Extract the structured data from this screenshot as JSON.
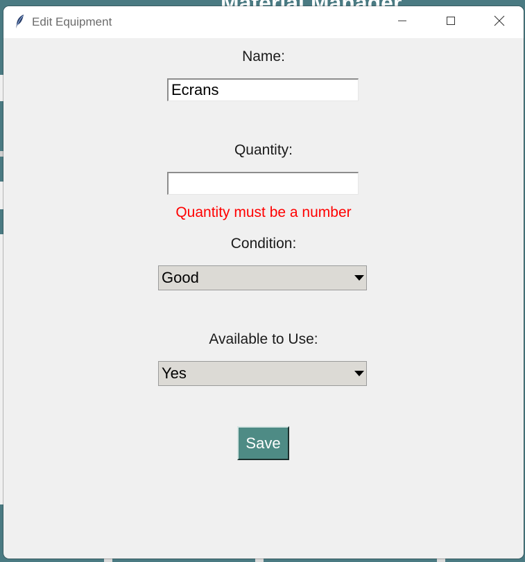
{
  "background_app": {
    "title": "Material Manager"
  },
  "window": {
    "title": "Edit Equipment",
    "icon": "feather-icon",
    "controls": {
      "minimize_icon": "minimize-icon",
      "maximize_icon": "maximize-icon",
      "close_icon": "close-icon"
    }
  },
  "form": {
    "name_label": "Name:",
    "name_value": "Ecrans",
    "quantity_label": "Quantity:",
    "quantity_value": "",
    "quantity_error": "Quantity must be a number",
    "condition_label": "Condition:",
    "condition_value": "Good",
    "available_label": "Available to Use:",
    "available_value": "Yes",
    "save_label": "Save"
  },
  "colors": {
    "accent": "#4e8b85",
    "error": "#ff0000",
    "background_app": "#4a7a82"
  }
}
